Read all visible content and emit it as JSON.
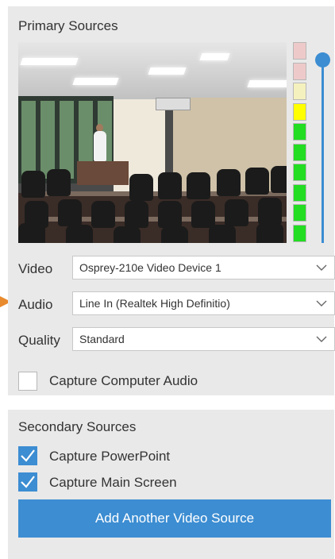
{
  "primary": {
    "title": "Primary Sources",
    "video_label": "Video",
    "video_value": "Osprey-210e Video Device 1",
    "audio_label": "Audio",
    "audio_value": "Line In (Realtek High Definitio)",
    "quality_label": "Quality",
    "quality_value": "Standard",
    "capture_audio_label": "Capture Computer Audio",
    "capture_audio_checked": false,
    "meter_colors": [
      "#eec9c9",
      "#eec9c9",
      "#f4f1bf",
      "#ffff00",
      "#22dd22",
      "#22dd22",
      "#22dd22",
      "#22dd22",
      "#22dd22",
      "#22dd22"
    ],
    "volume_level": 1.0
  },
  "secondary": {
    "title": "Secondary Sources",
    "powerpoint_label": "Capture PowerPoint",
    "powerpoint_checked": true,
    "main_screen_label": "Capture Main Screen",
    "main_screen_checked": true,
    "add_button_label": "Add Another Video Source"
  },
  "colors": {
    "accent": "#3c8dd2",
    "panel": "#e9e9e9",
    "indicator_arrow": "#e88a2e"
  },
  "icons": [
    "chevron-down-icon",
    "checkmark-icon",
    "indicator-arrow-icon"
  ]
}
